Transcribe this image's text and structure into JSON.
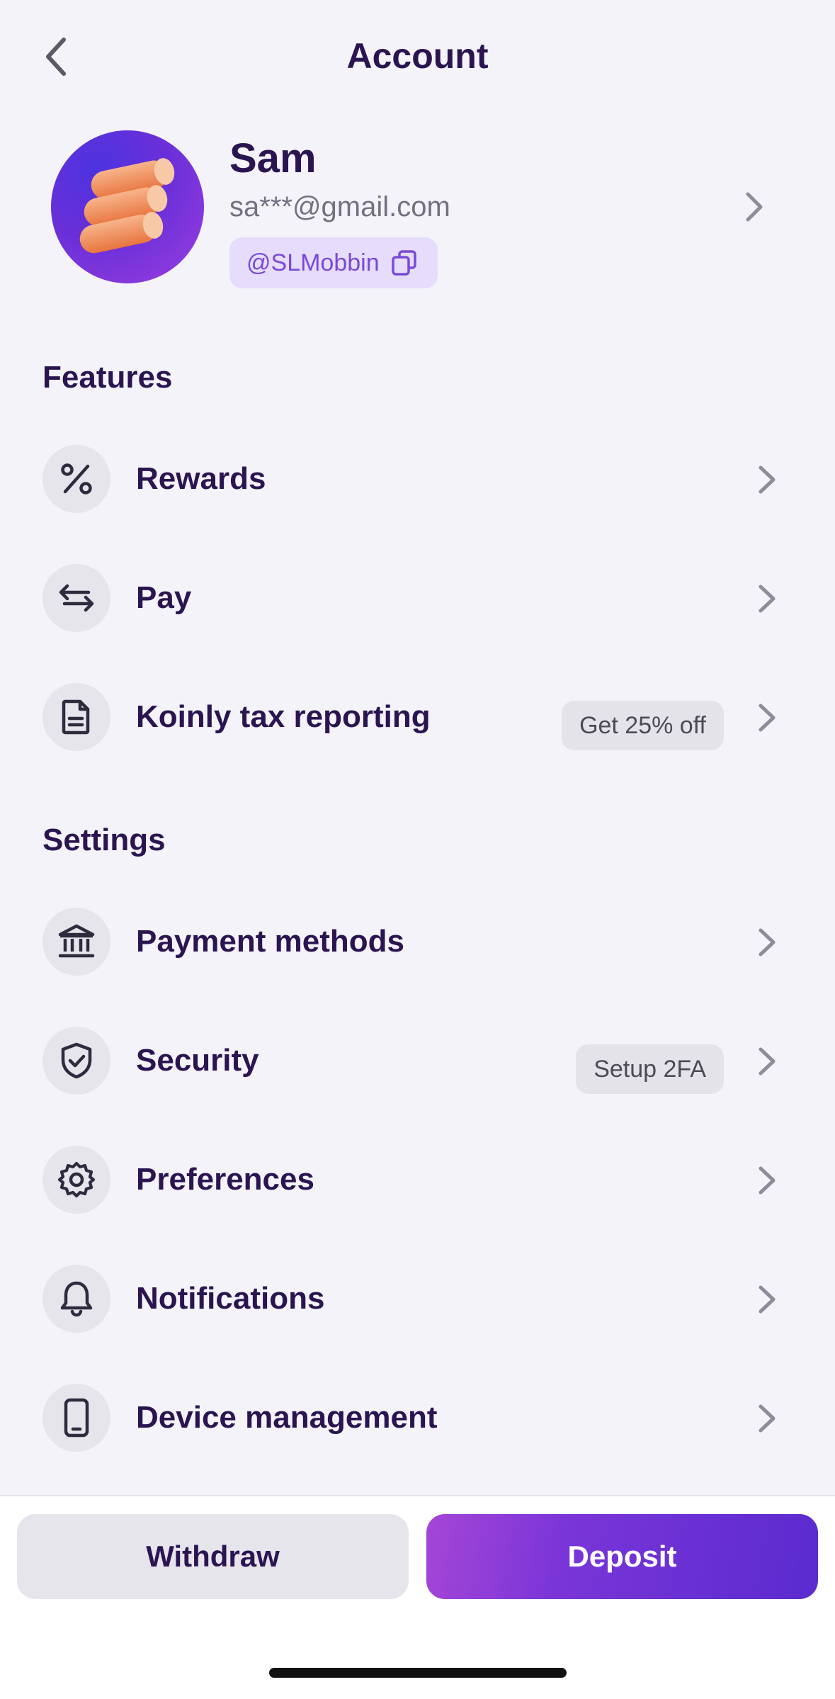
{
  "header": {
    "title": "Account"
  },
  "profile": {
    "name": "Sam",
    "email": "sa***@gmail.com",
    "handle": "@SLMobbin"
  },
  "features": {
    "title": "Features",
    "items": [
      {
        "label": "Rewards",
        "icon": "percent-icon",
        "badge": ""
      },
      {
        "label": "Pay",
        "icon": "transfer-arrows-icon",
        "badge": ""
      },
      {
        "label": "Koinly tax reporting",
        "icon": "document-icon",
        "badge": "Get 25% off"
      }
    ]
  },
  "settings": {
    "title": "Settings",
    "items": [
      {
        "label": "Payment methods",
        "icon": "bank-icon",
        "badge": ""
      },
      {
        "label": "Security",
        "icon": "shield-check-icon",
        "badge": "Setup 2FA"
      },
      {
        "label": "Preferences",
        "icon": "gear-icon",
        "badge": ""
      },
      {
        "label": "Notifications",
        "icon": "bell-icon",
        "badge": ""
      },
      {
        "label": "Device management",
        "icon": "phone-icon",
        "badge": ""
      }
    ]
  },
  "actions": {
    "withdraw": "Withdraw",
    "deposit": "Deposit"
  },
  "colors": {
    "primary_text": "#2a1551",
    "accent": "#5a2bcf",
    "page_bg": "#f4f3f9"
  }
}
